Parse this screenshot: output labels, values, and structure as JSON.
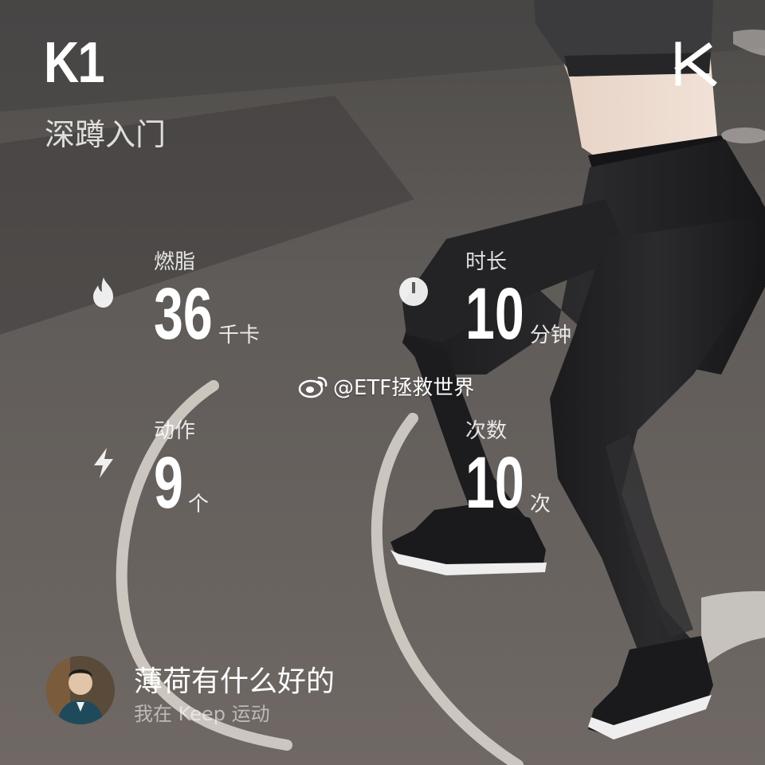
{
  "header": {
    "level": "K1",
    "course_name": "深蹲入门",
    "logo_icon": "keep-k-logo"
  },
  "stats": {
    "calories": {
      "label": "燃脂",
      "value": "36",
      "unit": "千卡",
      "icon": "flame-icon"
    },
    "duration": {
      "label": "时长",
      "value": "10",
      "unit": "分钟",
      "icon": "timer-icon"
    },
    "actions": {
      "label": "动作",
      "value": "9",
      "unit": "个",
      "icon": "lightning-icon"
    },
    "reps": {
      "label": "次数",
      "value": "10",
      "unit": "次",
      "icon": ""
    }
  },
  "watermark": {
    "icon": "weibo-icon",
    "text": "@ETF拯救世界"
  },
  "user": {
    "name": "薄荷有什么好的",
    "subtitle": "我在 Keep 运动",
    "avatar_icon": "avatar"
  },
  "colors": {
    "text": "#ffffff",
    "floor": "#5c5956",
    "ring": "#e8e4df"
  }
}
